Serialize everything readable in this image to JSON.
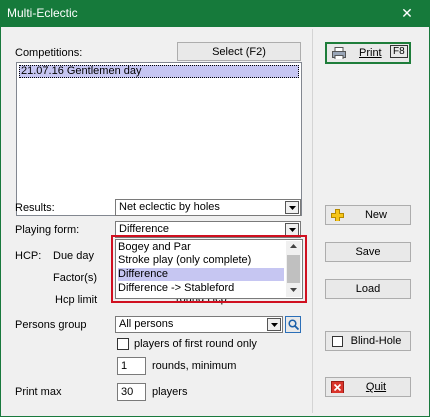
{
  "window": {
    "title": "Multi-Eclectic",
    "close_glyph": "✕"
  },
  "competitions": {
    "label": "Competitions:",
    "select_button": "Select (F2)",
    "items": [
      "21.07.16 Gentlemen day"
    ]
  },
  "results": {
    "label": "Results:",
    "value": "Net eclectic by holes"
  },
  "playing_form": {
    "label": "Playing form:",
    "value": "Difference",
    "options": [
      "Bogey and Par",
      "Stroke play (only complete)",
      "Difference",
      "Difference -> Stableford"
    ],
    "selected_index": 2
  },
  "hcp": {
    "label": "HCP:",
    "due_day_label": "Due day",
    "factor_label": "Factor(s)",
    "hcp_limit_label": "Hcp limit",
    "round_hcp_label": "round Hcp"
  },
  "persons_group": {
    "label": "Persons group",
    "value": "All persons",
    "first_round_label": "players of first round only",
    "rounds_value": "1",
    "rounds_label": "rounds, minimum"
  },
  "print_max": {
    "label": "Print max",
    "value": "30",
    "unit": "players"
  },
  "side_buttons": {
    "print": "Print",
    "print_key": "F8",
    "new": "New",
    "save": "Save",
    "load": "Load",
    "blind_hole": "Blind-Hole",
    "quit": "Quit"
  },
  "colors": {
    "title_bar": "#167a3b",
    "selection": "#c6c6f2",
    "highlight_border": "#d01020"
  }
}
